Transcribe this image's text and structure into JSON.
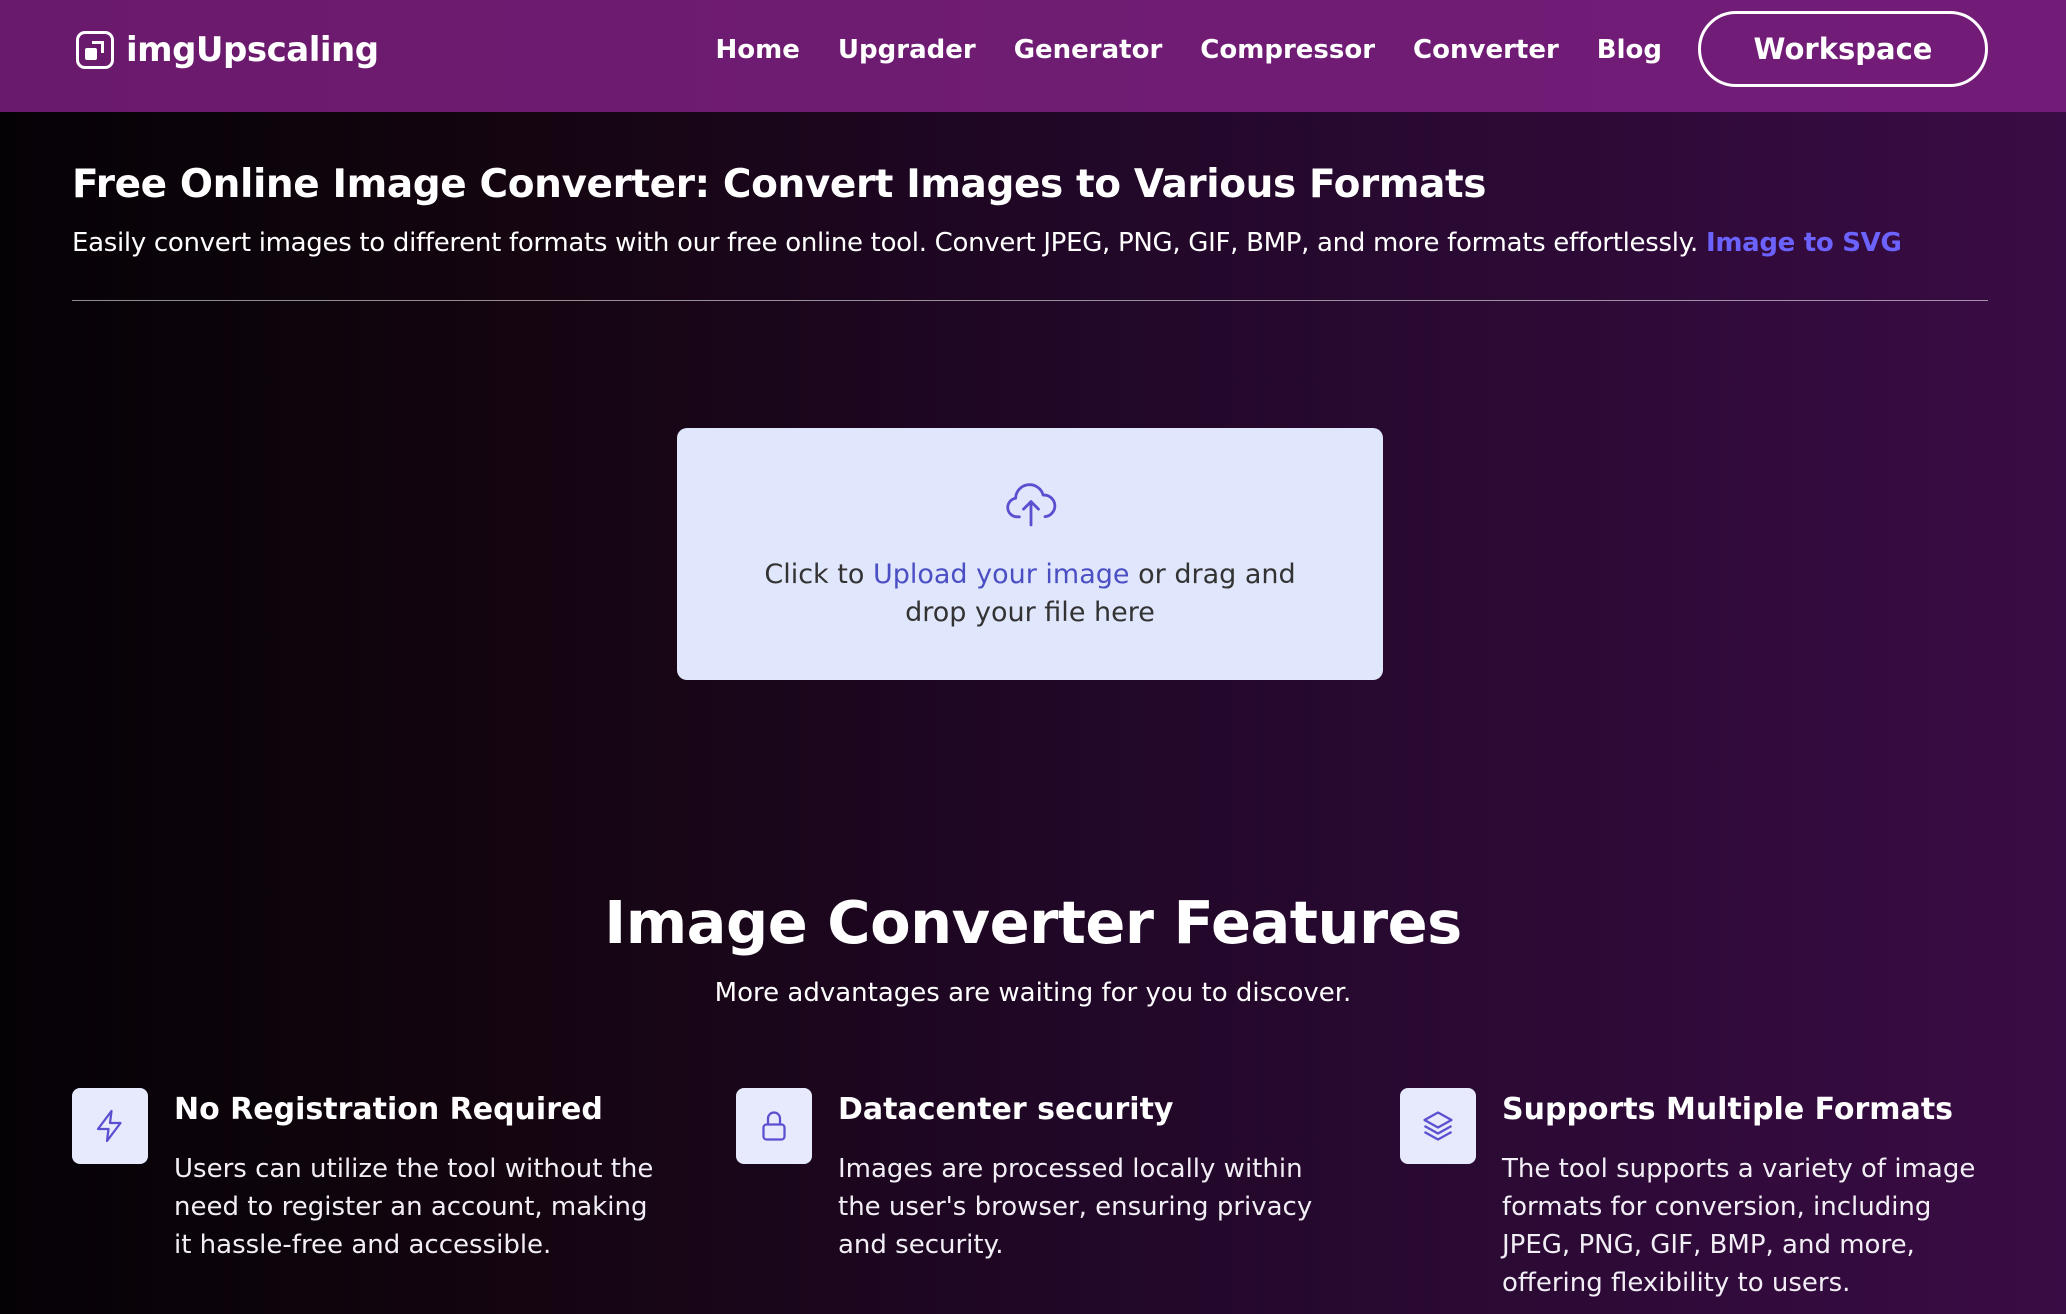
{
  "navbar": {
    "brand": "imgUpscaling",
    "links": [
      "Home",
      "Upgrader",
      "Generator",
      "Compressor",
      "Converter",
      "Blog"
    ],
    "workspace_label": "Workspace"
  },
  "header": {
    "title": "Free Online Image Converter: Convert Images to Various Formats",
    "subtitle": "Easily convert images to different formats with our free online tool. Convert JPEG, PNG, GIF, BMP, and more formats effortlessly.",
    "subtitle_link": "Image to SVG"
  },
  "upload": {
    "prefix": "Click to ",
    "link": "Upload your image",
    "suffix": " or drag and drop your file here",
    "icon": "cloud-upload-icon"
  },
  "features": {
    "title": "Image Converter Features",
    "subtitle": "More advantages are waiting for you to discover.",
    "items": [
      {
        "icon": "lightning-icon",
        "title": "No Registration Required",
        "description": "Users can utilize the tool without the need to register an account, making it hassle-free and accessible."
      },
      {
        "icon": "lock-icon",
        "title": "Datacenter security",
        "description": "Images are processed locally within the user's browser, ensuring privacy and security."
      },
      {
        "icon": "layers-icon",
        "title": "Supports Multiple Formats",
        "description": "The tool supports a variety of image formats for conversion, including JPEG, PNG, GIF, BMP, and more, offering flexibility to users."
      }
    ]
  },
  "colors": {
    "navbar": "#6f1c73",
    "accent_link": "#6c63ff",
    "upload_bg": "#e0e6fb",
    "icon_stroke": "#5a4fd0"
  }
}
